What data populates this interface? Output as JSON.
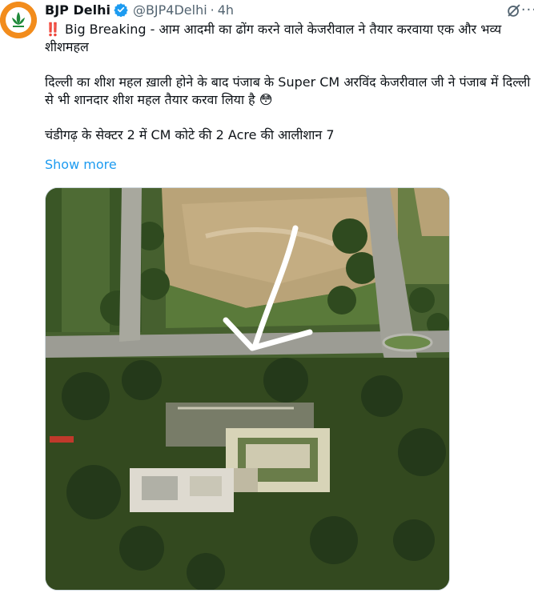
{
  "tweet": {
    "author_name": "BJP Delhi",
    "handle": "@BJP4Delhi",
    "separator": "·",
    "time": "4h",
    "line1_prefix": "‼️",
    "line1": "Big Breaking - आम आदमी का ढोंग करने वाले केजरीवाल ने तैयार करवाया एक और भव्य शीशमहल",
    "line2": "दिल्ली का शीश महल ख़ाली होने के बाद पंजाब के Super CM अरविंद केजरीवाल जी ने पंजाब में दिल्ली से भी शानदार शीश महल तैयार करवा लिया है 😳",
    "line3": "चंडीगढ़ के सेक्टर 2 में CM कोटे की 2 Acre की आलीशान 7",
    "show_more": "Show more"
  },
  "icons": {
    "avatar": "bjp-lotus-logo",
    "verified": "verified-badge-icon",
    "grok": "grok-icon",
    "more": "more-icon"
  },
  "colors": {
    "link": "#1d9bf0",
    "secondary_text": "#536471",
    "avatar_bg": "#f28c1c"
  },
  "media": {
    "description_icon": "aerial-photo",
    "arrow": "white-arrow"
  }
}
